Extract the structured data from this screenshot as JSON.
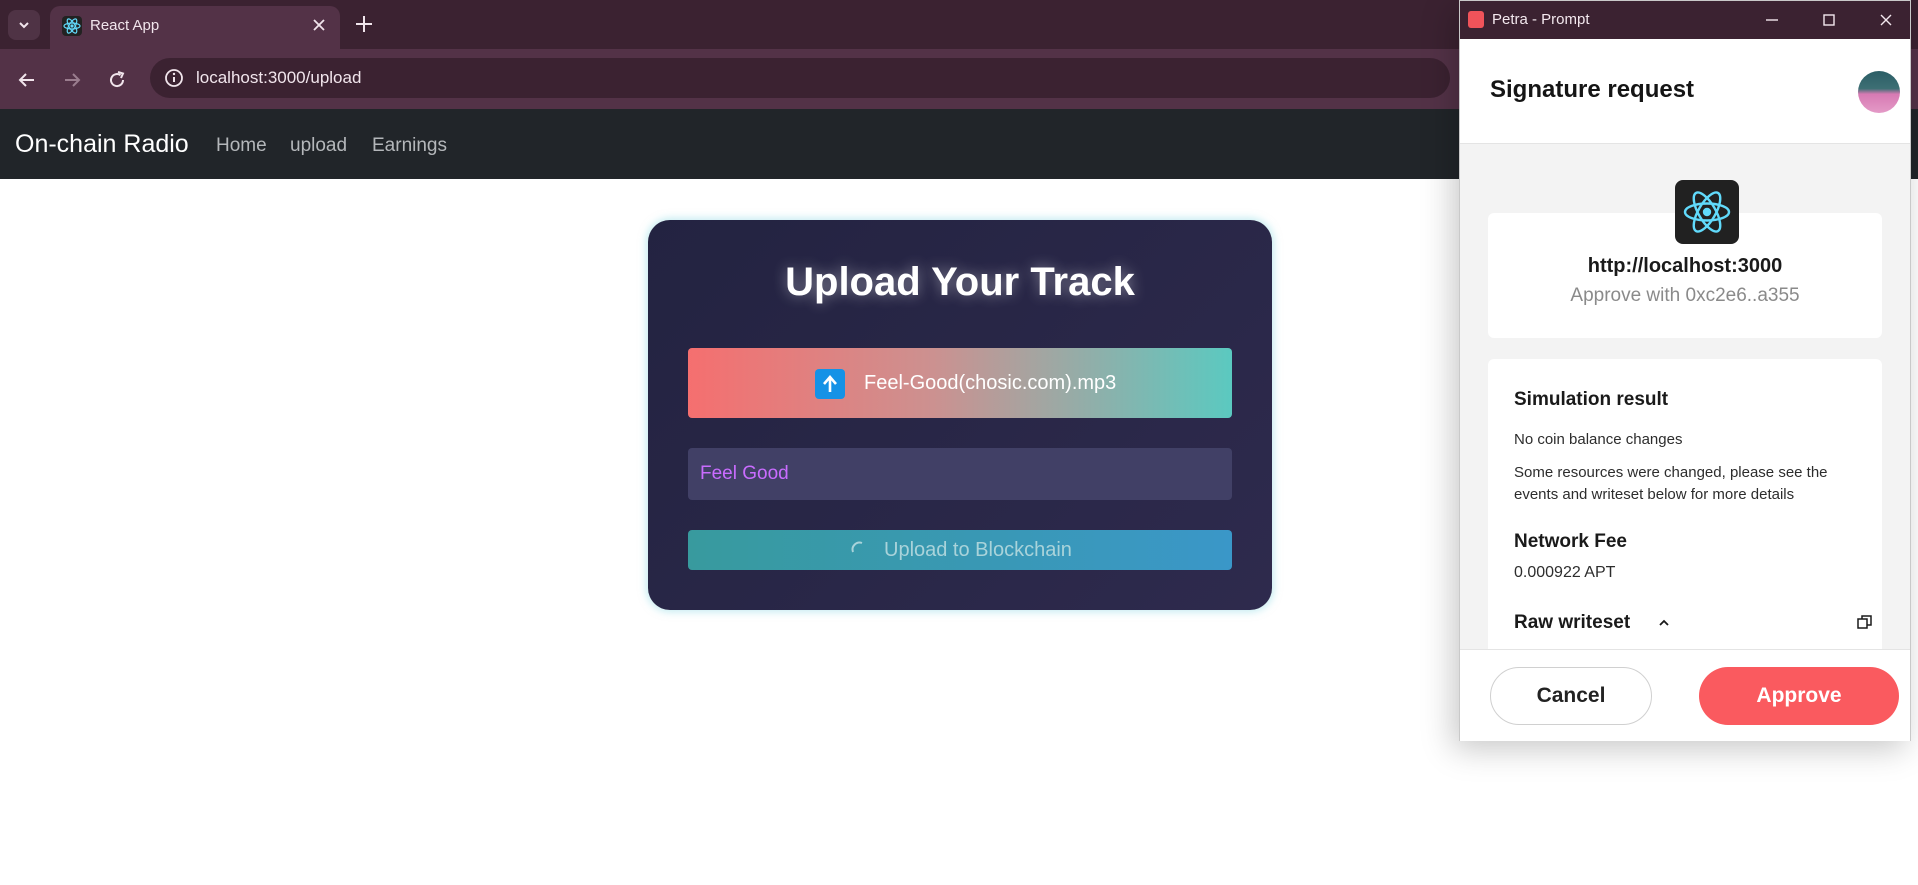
{
  "browser": {
    "tab_title": "React App",
    "url": "localhost:3000/upload"
  },
  "navbar": {
    "brand": "On-chain Radio",
    "links": [
      "Home",
      "upload",
      "Earnings"
    ]
  },
  "upload_card": {
    "title": "Upload Your Track",
    "file_name": "Feel-Good(chosic.com).mp3",
    "track_title_value": "Feel Good",
    "submit_label": "Upload to Blockchain"
  },
  "petra": {
    "window_title": "Petra - Prompt",
    "heading": "Signature request",
    "origin_url": "http://localhost:3000",
    "approve_with": "Approve with 0xc2e6..a355",
    "simulation_title": "Simulation result",
    "balance_text": "No coin balance changes",
    "resources_line1": "Some resources were changed, please see the",
    "resources_line2": "events and writeset below for more details",
    "fee_title": "Network Fee",
    "fee_value": "0.000922 APT",
    "raw_writeset": "Raw writeset",
    "cancel_label": "Cancel",
    "approve_label": "Approve",
    "accent_color": "#fa5a5f"
  },
  "icons": [
    "tab-list-icon",
    "react-favicon-icon",
    "tab-close-icon",
    "new-tab-icon",
    "back-icon",
    "forward-icon",
    "reload-icon",
    "site-info-icon",
    "upload-arrow-icon",
    "loading-spinner-icon",
    "petra-logo-icon",
    "minimize-icon",
    "maximize-icon",
    "window-close-icon",
    "react-app-icon",
    "chevron-up-icon",
    "copy-icon"
  ]
}
